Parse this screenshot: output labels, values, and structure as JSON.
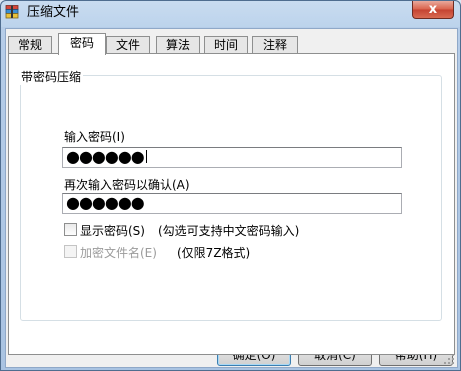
{
  "window": {
    "title": "压缩文件",
    "close_glyph": "x"
  },
  "tabs": [
    {
      "label": "常规"
    },
    {
      "label": "密码",
      "active": true
    },
    {
      "label": "文件"
    },
    {
      "label": "算法"
    },
    {
      "label": "时间"
    },
    {
      "label": "注释"
    }
  ],
  "group": {
    "title": "带密码压缩",
    "password_label": "输入密码(I)",
    "password_value": "●●●●●●",
    "confirm_label": "再次输入密码以确认(A)",
    "confirm_value": "●●●●●●",
    "show_password_label": "显示密码(S)",
    "show_password_checked": false,
    "show_password_note": "(勾选可支持中文密码输入)",
    "encrypt_names_label": "加密文件名(E)",
    "encrypt_names_checked": false,
    "encrypt_names_enabled": false,
    "encrypt_names_note": "(仅限7Z格式)"
  },
  "buttons": {
    "ok": "确定(O)",
    "cancel": "取消(C)",
    "help": "帮助(H)"
  },
  "colors": {
    "titlebar": "#bcd3ec",
    "close_button": "#d9614a",
    "default_button_border": "#3c7fb1"
  }
}
